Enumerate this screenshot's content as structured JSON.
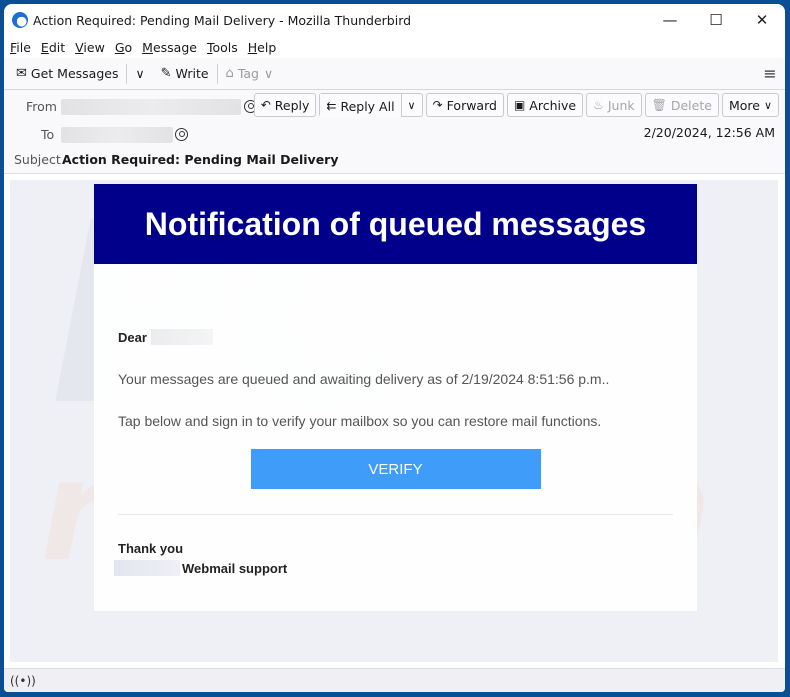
{
  "window": {
    "title": "Action Required: Pending Mail Delivery - Mozilla Thunderbird",
    "controls": {
      "minimize": "—",
      "maximize": "☐",
      "close": "✕"
    }
  },
  "menubar": {
    "items": [
      {
        "accel": "F",
        "rest": "ile"
      },
      {
        "accel": "E",
        "rest": "dit"
      },
      {
        "accel": "V",
        "rest": "iew"
      },
      {
        "accel": "G",
        "rest": "o"
      },
      {
        "accel": "M",
        "rest": "essage"
      },
      {
        "accel": "T",
        "rest": "ools"
      },
      {
        "accel": "H",
        "rest": "elp"
      }
    ]
  },
  "toolbar": {
    "get_messages": "Get Messages",
    "write": "Write",
    "tag": "Tag",
    "icons": {
      "get_messages": "✉",
      "dropdown": "∨",
      "write": "✎",
      "tag": "⌂",
      "menu": "≡"
    }
  },
  "header": {
    "from_label": "From",
    "to_label": "To",
    "subject_label": "Subject",
    "subject": "Action Required: Pending Mail Delivery",
    "date": "2/20/2024, 12:56 AM",
    "actions": {
      "reply": "Reply",
      "reply_all": "Reply All",
      "forward": "Forward",
      "archive": "Archive",
      "junk": "Junk",
      "delete": "Delete",
      "more": "More"
    },
    "action_icons": {
      "reply": "↶",
      "reply_all": "⇇",
      "forward": "↷",
      "archive": "▣",
      "junk": "♨",
      "delete": "🗑",
      "chevron": "∨"
    }
  },
  "email": {
    "banner_title": "Notification of queued messages",
    "greeting": "Dear",
    "paragraph1": "Your messages are queued and awaiting delivery as of 2/19/2024 8:51:56 p.m..",
    "paragraph2": "Tap below and sign in to verify your mailbox so you can restore mail functions.",
    "button_label": "VERIFY",
    "closing": "Thank you",
    "signature": "Webmail support",
    "colors": {
      "banner": "#00008b",
      "button": "#3f9cf9"
    }
  },
  "watermark": {
    "top": "PC",
    "bottom": "risk.com"
  },
  "statusbar": {
    "icon": "((•))"
  }
}
